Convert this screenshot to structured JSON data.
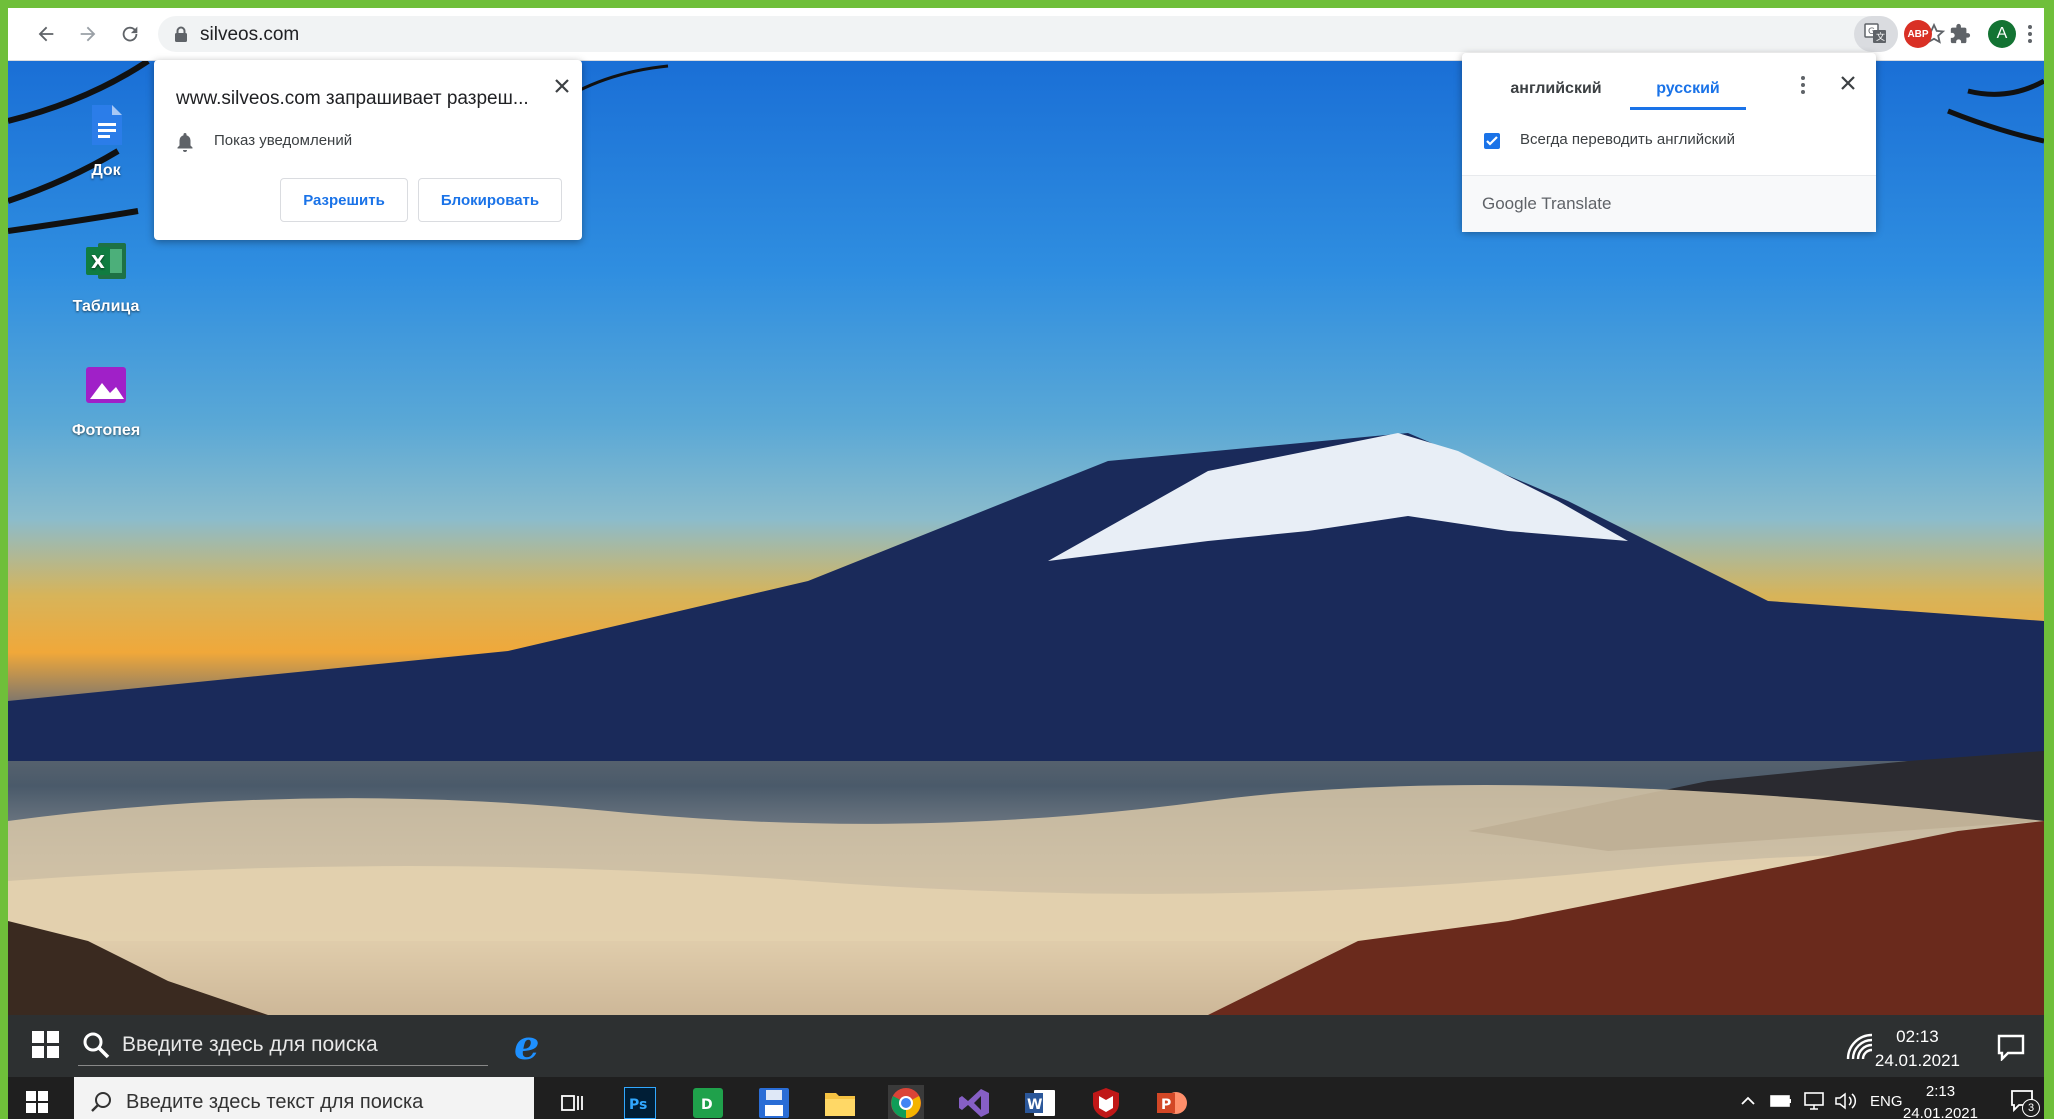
{
  "browser": {
    "url": "silveos.com"
  },
  "desktop_icons": [
    {
      "label": "Док"
    },
    {
      "label": "Таблица"
    },
    {
      "label": "Фотопея"
    }
  ],
  "permission_prompt": {
    "title": "www.silveos.com запрашивает разреш...",
    "permission": "Показ уведомлений",
    "allow_label": "Разрешить",
    "block_label": "Блокировать"
  },
  "translate_bubble": {
    "tabs": [
      "английский",
      "русский"
    ],
    "active_tab": "русский",
    "always_translate_label": "Всегда переводить английский",
    "always_translate_checked": true,
    "footer": "Google Translate"
  },
  "inner_taskbar": {
    "search_placeholder": "Введите здесь для поиска",
    "time": "02:13",
    "date": "24.01.2021"
  },
  "windows_taskbar": {
    "search_placeholder": "Введите здесь текст для поиска",
    "language": "ENG",
    "time": "2:13",
    "date": "24.01.2021",
    "notification_count": "3"
  },
  "colors": {
    "accent_blue": "#1a73e8",
    "abp_red": "#d93025",
    "avatar_green": "#137333"
  }
}
